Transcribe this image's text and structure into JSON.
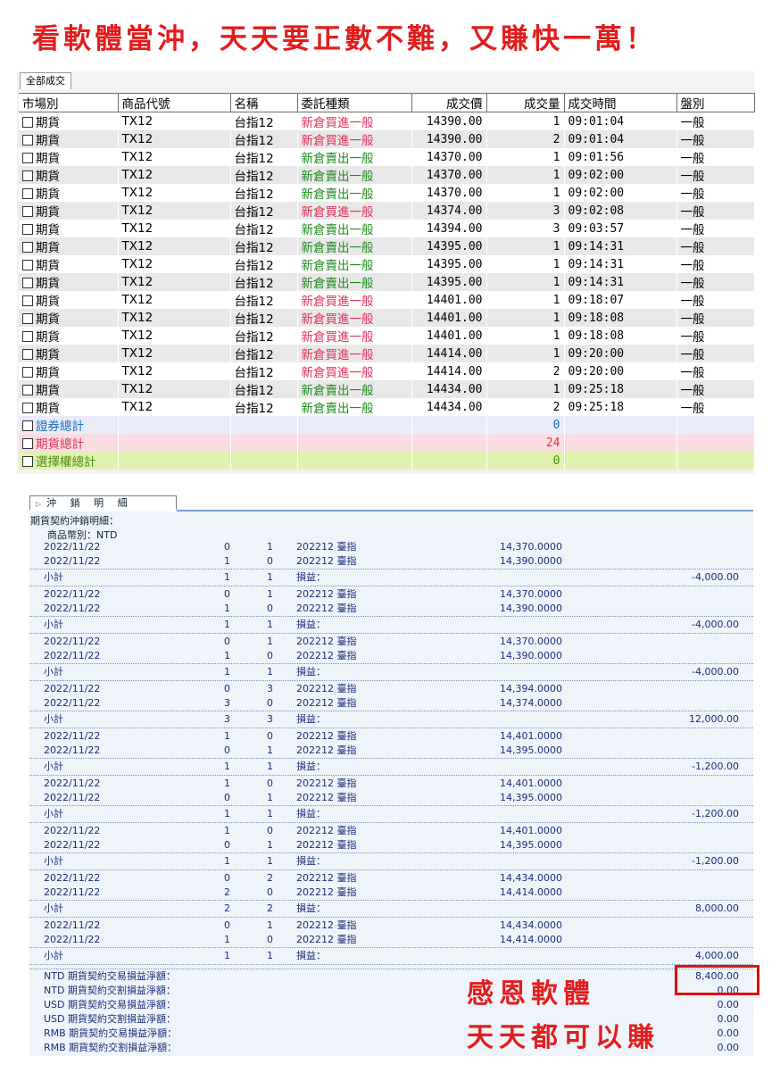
{
  "banner": "看軟體當沖，天天要正數不難，又賺快一萬！",
  "tab_all_trades": "全部成交",
  "columns": [
    "市場別",
    "商品代號",
    "名稱",
    "委託種類",
    "成交價",
    "成交量",
    "成交時間",
    "盤別"
  ],
  "trades": [
    {
      "market": "期貨",
      "code": "TX12",
      "name": "台指12",
      "type": "新倉買進一般",
      "side": "buy",
      "price": "14390.00",
      "qty": "1",
      "time": "09:01:04",
      "session": "一般"
    },
    {
      "market": "期貨",
      "code": "TX12",
      "name": "台指12",
      "type": "新倉買進一般",
      "side": "buy",
      "price": "14390.00",
      "qty": "2",
      "time": "09:01:04",
      "session": "一般"
    },
    {
      "market": "期貨",
      "code": "TX12",
      "name": "台指12",
      "type": "新倉賣出一般",
      "side": "sell",
      "price": "14370.00",
      "qty": "1",
      "time": "09:01:56",
      "session": "一般"
    },
    {
      "market": "期貨",
      "code": "TX12",
      "name": "台指12",
      "type": "新倉賣出一般",
      "side": "sell",
      "price": "14370.00",
      "qty": "1",
      "time": "09:02:00",
      "session": "一般"
    },
    {
      "market": "期貨",
      "code": "TX12",
      "name": "台指12",
      "type": "新倉賣出一般",
      "side": "sell",
      "price": "14370.00",
      "qty": "1",
      "time": "09:02:00",
      "session": "一般"
    },
    {
      "market": "期貨",
      "code": "TX12",
      "name": "台指12",
      "type": "新倉買進一般",
      "side": "buy",
      "price": "14374.00",
      "qty": "3",
      "time": "09:02:08",
      "session": "一般"
    },
    {
      "market": "期貨",
      "code": "TX12",
      "name": "台指12",
      "type": "新倉賣出一般",
      "side": "sell",
      "price": "14394.00",
      "qty": "3",
      "time": "09:03:57",
      "session": "一般"
    },
    {
      "market": "期貨",
      "code": "TX12",
      "name": "台指12",
      "type": "新倉賣出一般",
      "side": "sell",
      "price": "14395.00",
      "qty": "1",
      "time": "09:14:31",
      "session": "一般"
    },
    {
      "market": "期貨",
      "code": "TX12",
      "name": "台指12",
      "type": "新倉賣出一般",
      "side": "sell",
      "price": "14395.00",
      "qty": "1",
      "time": "09:14:31",
      "session": "一般"
    },
    {
      "market": "期貨",
      "code": "TX12",
      "name": "台指12",
      "type": "新倉賣出一般",
      "side": "sell",
      "price": "14395.00",
      "qty": "1",
      "time": "09:14:31",
      "session": "一般"
    },
    {
      "market": "期貨",
      "code": "TX12",
      "name": "台指12",
      "type": "新倉買進一般",
      "side": "buy",
      "price": "14401.00",
      "qty": "1",
      "time": "09:18:07",
      "session": "一般"
    },
    {
      "market": "期貨",
      "code": "TX12",
      "name": "台指12",
      "type": "新倉買進一般",
      "side": "buy",
      "price": "14401.00",
      "qty": "1",
      "time": "09:18:08",
      "session": "一般"
    },
    {
      "market": "期貨",
      "code": "TX12",
      "name": "台指12",
      "type": "新倉買進一般",
      "side": "buy",
      "price": "14401.00",
      "qty": "1",
      "time": "09:18:08",
      "session": "一般"
    },
    {
      "market": "期貨",
      "code": "TX12",
      "name": "台指12",
      "type": "新倉買進一般",
      "side": "buy",
      "price": "14414.00",
      "qty": "1",
      "time": "09:20:00",
      "session": "一般"
    },
    {
      "market": "期貨",
      "code": "TX12",
      "name": "台指12",
      "type": "新倉買進一般",
      "side": "buy",
      "price": "14414.00",
      "qty": "2",
      "time": "09:20:00",
      "session": "一般"
    },
    {
      "market": "期貨",
      "code": "TX12",
      "name": "台指12",
      "type": "新倉賣出一般",
      "side": "sell",
      "price": "14434.00",
      "qty": "1",
      "time": "09:25:18",
      "session": "一般"
    },
    {
      "market": "期貨",
      "code": "TX12",
      "name": "台指12",
      "type": "新倉賣出一般",
      "side": "sell",
      "price": "14434.00",
      "qty": "2",
      "time": "09:25:18",
      "session": "一般"
    }
  ],
  "summary": [
    {
      "label": "證券總計",
      "qty": "0",
      "kind": "sec"
    },
    {
      "label": "期貨總計",
      "qty": "24",
      "kind": "fut"
    },
    {
      "label": "選擇權總計",
      "qty": "0",
      "kind": "opt"
    }
  ],
  "detail": {
    "tab_label": "沖 銷 明 細",
    "title": "期貨契約沖銷明細：",
    "currency": "商品幣別：NTD",
    "pl_label": "損益：",
    "subtotal_label": "小計",
    "groups": [
      {
        "rows": [
          [
            "2022/11/22",
            "0",
            "1",
            "202212 臺指",
            "14,370.0000"
          ],
          [
            "2022/11/22",
            "1",
            "0",
            "202212 臺指",
            "14,390.0000"
          ]
        ],
        "sub": [
          "1",
          "1"
        ],
        "pl": "-4,000.00"
      },
      {
        "rows": [
          [
            "2022/11/22",
            "0",
            "1",
            "202212 臺指",
            "14,370.0000"
          ],
          [
            "2022/11/22",
            "1",
            "0",
            "202212 臺指",
            "14,390.0000"
          ]
        ],
        "sub": [
          "1",
          "1"
        ],
        "pl": "-4,000.00"
      },
      {
        "rows": [
          [
            "2022/11/22",
            "0",
            "1",
            "202212 臺指",
            "14,370.0000"
          ],
          [
            "2022/11/22",
            "1",
            "0",
            "202212 臺指",
            "14,390.0000"
          ]
        ],
        "sub": [
          "1",
          "1"
        ],
        "pl": "-4,000.00"
      },
      {
        "rows": [
          [
            "2022/11/22",
            "0",
            "3",
            "202212 臺指",
            "14,394.0000"
          ],
          [
            "2022/11/22",
            "3",
            "0",
            "202212 臺指",
            "14,374.0000"
          ]
        ],
        "sub": [
          "3",
          "3"
        ],
        "pl": "12,000.00"
      },
      {
        "rows": [
          [
            "2022/11/22",
            "1",
            "0",
            "202212 臺指",
            "14,401.0000"
          ],
          [
            "2022/11/22",
            "0",
            "1",
            "202212 臺指",
            "14,395.0000"
          ]
        ],
        "sub": [
          "1",
          "1"
        ],
        "pl": "-1,200.00"
      },
      {
        "rows": [
          [
            "2022/11/22",
            "1",
            "0",
            "202212 臺指",
            "14,401.0000"
          ],
          [
            "2022/11/22",
            "0",
            "1",
            "202212 臺指",
            "14,395.0000"
          ]
        ],
        "sub": [
          "1",
          "1"
        ],
        "pl": "-1,200.00"
      },
      {
        "rows": [
          [
            "2022/11/22",
            "1",
            "0",
            "202212 臺指",
            "14,401.0000"
          ],
          [
            "2022/11/22",
            "0",
            "1",
            "202212 臺指",
            "14,395.0000"
          ]
        ],
        "sub": [
          "1",
          "1"
        ],
        "pl": "-1,200.00"
      },
      {
        "rows": [
          [
            "2022/11/22",
            "0",
            "2",
            "202212 臺指",
            "14,434.0000"
          ],
          [
            "2022/11/22",
            "2",
            "0",
            "202212 臺指",
            "14,414.0000"
          ]
        ],
        "sub": [
          "2",
          "2"
        ],
        "pl": "8,000.00"
      },
      {
        "rows": [
          [
            "2022/11/22",
            "0",
            "1",
            "202212 臺指",
            "14,434.0000"
          ],
          [
            "2022/11/22",
            "1",
            "0",
            "202212 臺指",
            "14,414.0000"
          ]
        ],
        "sub": [
          "1",
          "1"
        ],
        "pl": "4,000.00"
      }
    ],
    "totals": [
      {
        "label": "NTD 期貨契約交易損益淨額：",
        "value": "8,400.00"
      },
      {
        "label": "NTD 期貨契約交割損益淨額：",
        "value": "0.00"
      },
      {
        "label": "USD 期貨契約交易損益淨額：",
        "value": "0.00"
      },
      {
        "label": "USD 期貨契約交割損益淨額：",
        "value": "0.00"
      },
      {
        "label": "RMB 期貨契約交易損益淨額：",
        "value": "0.00"
      },
      {
        "label": "RMB 期貨契約交割損益淨額：",
        "value": "0.00"
      }
    ]
  },
  "overlay": {
    "line1": "感恩軟體",
    "line2": "天天都可以賺"
  },
  "colors": {
    "banner": "#e21d1d",
    "buy": "#e0305a",
    "sell": "#1f8a1f",
    "highlight_box": "#e01010"
  }
}
